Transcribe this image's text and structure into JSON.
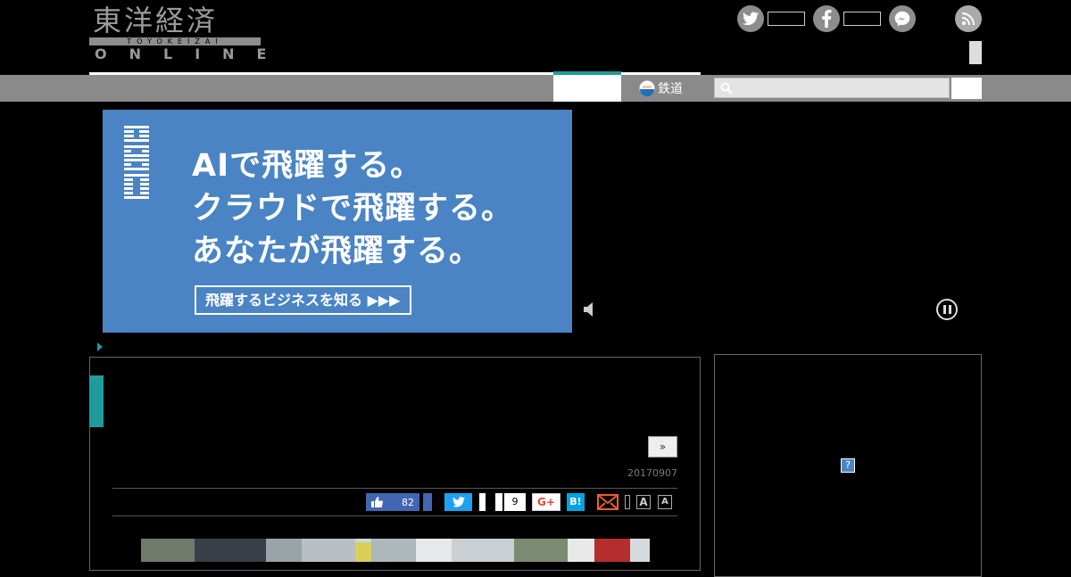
{
  "header": {
    "logo_kanji": "東洋経済",
    "logo_romaji": "TOYOKEIZAI",
    "logo_online": "ONLINE"
  },
  "nav": {
    "rail_label": "鉄道"
  },
  "search": {
    "placeholder": ""
  },
  "ad": {
    "brand": "IBM",
    "lines": [
      "AIで飛躍する。",
      "クラウドで飛躍する。",
      "あなたが飛躍する。"
    ],
    "cta": "飛躍するビジネスを知る ▶▶▶"
  },
  "article": {
    "next_label": "»",
    "date": "20170907"
  },
  "share": {
    "like_count": "82",
    "tweet_count": "9",
    "gplus_label": "G+",
    "hatena_label": "B!",
    "font_large": "A",
    "font_small": "A"
  },
  "sidebar": {
    "adchoice_label": "?"
  },
  "colors": {
    "accent": "#1f9b9b",
    "ad_blue": "#4a84c4",
    "facebook": "#4267b2",
    "twitter": "#1da1f2",
    "hatena": "#00a4de"
  }
}
